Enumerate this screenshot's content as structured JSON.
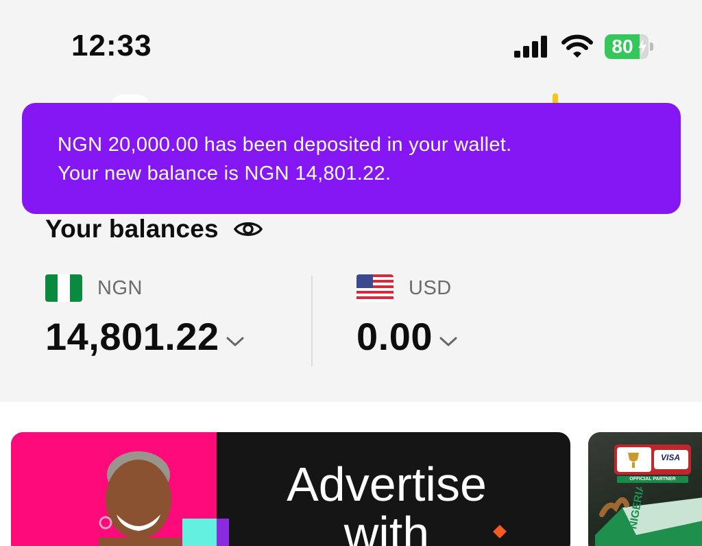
{
  "status_bar": {
    "time": "12:33",
    "battery_level": "80"
  },
  "toast": {
    "line1": "NGN 20,000.00 has been deposited in your wallet.",
    "line2": "Your new balance is NGN 14,801.22.",
    "background_color": "#8517f5"
  },
  "balances": {
    "title": "Your balances",
    "accounts": [
      {
        "currency": "NGN",
        "amount": "14,801.22",
        "flag_icon": "nigeria-flag-icon"
      },
      {
        "currency": "USD",
        "amount": "0.00",
        "flag_icon": "us-flag-icon"
      }
    ]
  },
  "banners": {
    "ad_headline": "Advertise with",
    "afcon_visa_label": "VISA",
    "afcon_partner_label": "OFFICIAL PARTNER"
  }
}
